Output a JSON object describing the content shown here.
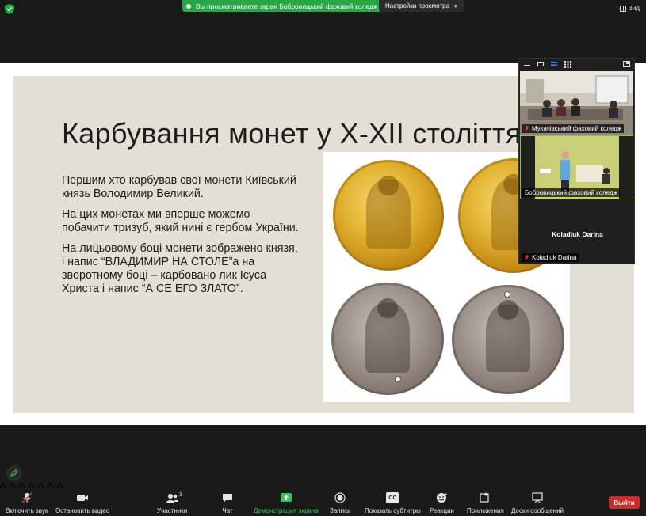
{
  "topbar": {
    "share_banner": "Вы просматриваете экран Бобровицький фаховий коледж",
    "view_settings": "Настройки просмотра",
    "view_label": "Вид"
  },
  "slide": {
    "title": "Карбування монет у Х-ХІІ століттях",
    "paragraphs": [
      "Першим хто карбував свої монети Київський князь Володимир Великий.",
      "На цих монетах ми вперше можемо побачити тризуб, який нині є гербом України.",
      "На лицьовому боці монети зображено князя, і напис “ВЛАДИМИР НА СТОЛЕ”а на  зворотному боці – карбовано лик Ісуса Христа і напис “А СЕ ЕГО ЗЛАТО”."
    ]
  },
  "participants": {
    "tiles": [
      {
        "name": "Мукачівський фаховий коледж",
        "muted": true
      },
      {
        "name": "Бобровицький фаховий коледж",
        "muted": false
      },
      {
        "name": "Koladiuk Darina",
        "display_name": "Koladiuk Darina",
        "muted": true
      }
    ]
  },
  "toolbar": {
    "mute": "Включить звук",
    "video": "Остановить видео",
    "participants": "Участники",
    "participants_count": "3",
    "chat": "Чат",
    "share": "Демонстрация экрана",
    "record": "Запись",
    "captions": "Показать субтитры",
    "captions_badge": "CC",
    "reactions": "Реакции",
    "apps": "Приложения",
    "whiteboard": "Доски сообщений",
    "leave": "Выйти"
  },
  "colors": {
    "share_green": "#27a845",
    "leave_red": "#d02b2b",
    "active_tile_border": "#8ac240",
    "slide_bg": "#e4dfd4"
  },
  "icons": [
    "shield-icon",
    "grid-view-icon",
    "microphone-muted-icon",
    "video-camera-icon",
    "participants-icon",
    "chat-icon",
    "share-screen-icon",
    "record-icon",
    "captions-icon",
    "reactions-icon",
    "apps-icon",
    "whiteboard-icon",
    "pencil-icon"
  ]
}
